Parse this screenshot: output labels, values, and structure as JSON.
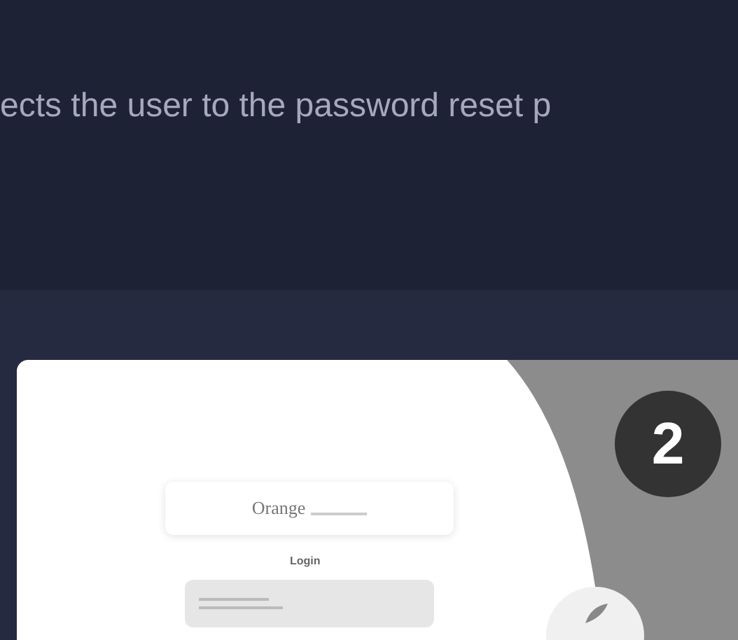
{
  "caption": "ects the user to the password reset p",
  "screenshot": {
    "logo": "Orange",
    "heading": "Login",
    "step_badge": "2"
  }
}
